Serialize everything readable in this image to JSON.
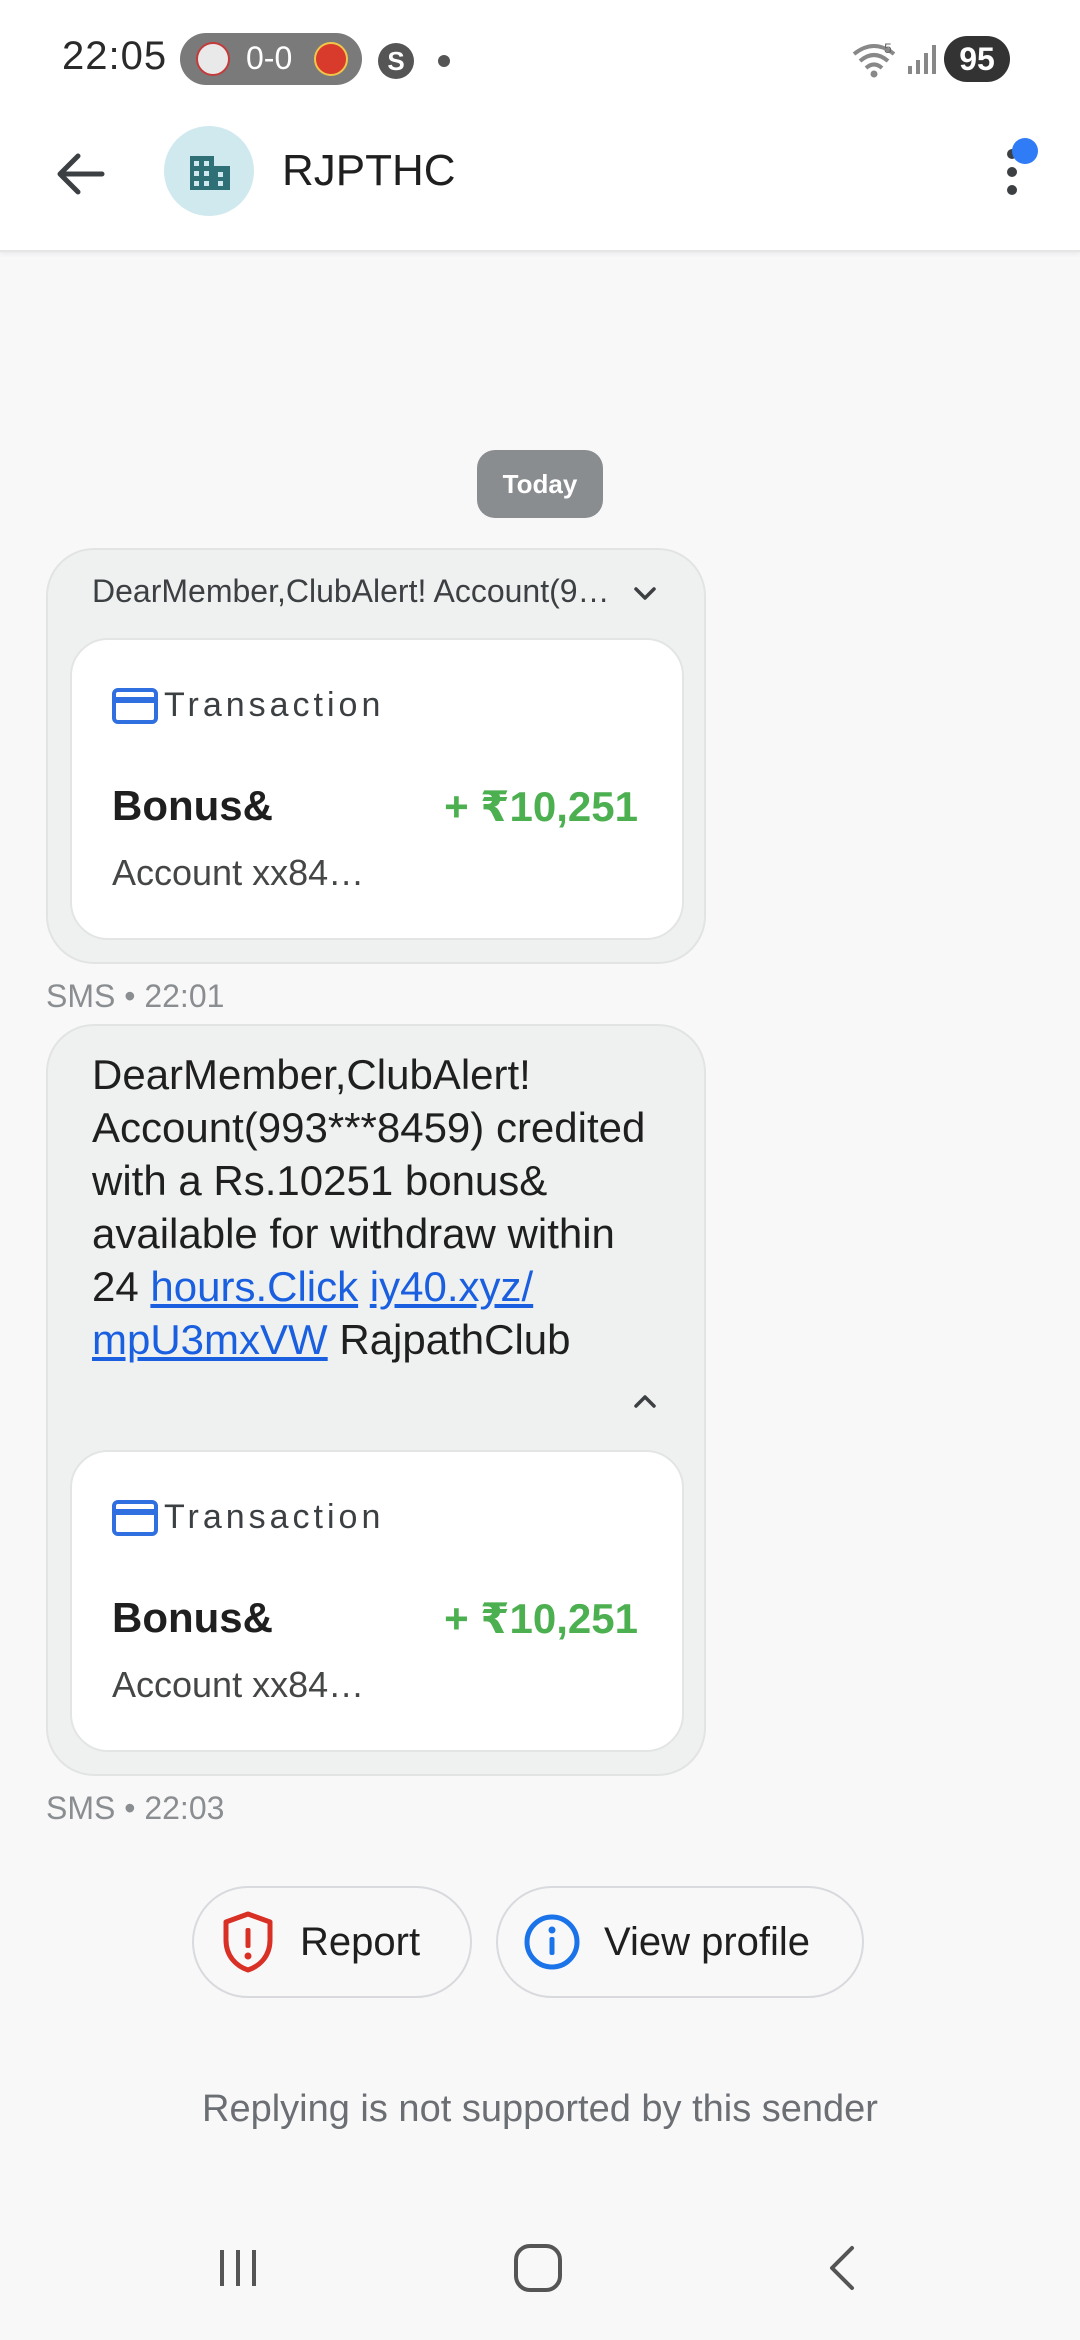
{
  "status_bar": {
    "time": "22:05",
    "score": "0-0",
    "s_badge": "S",
    "wifi_badge": "5",
    "battery": "95"
  },
  "header": {
    "contact_name": "RJPTHC"
  },
  "conversation": {
    "date_chip": "Today",
    "messages": [
      {
        "preview": "DearMember,ClubAlert! Account(9…",
        "card": {
          "label": "Transaction",
          "title": "Bonus&",
          "amount": "+ ₹10,251",
          "subtitle": "Account xx84…"
        },
        "meta": "SMS • 22:01"
      },
      {
        "text_plain": "DearMember,ClubAlert! Account(993***8459) credited with a Rs.10251 bonus& available for withdraw within 24",
        "link1": "hours.Click",
        "link2_line1": "iy40.xyz/",
        "link2_line2": "mpU3mxVW",
        "text_tail": "RajpathClub",
        "card": {
          "label": "Transaction",
          "title": "Bonus&",
          "amount": "+ ₹10,251",
          "subtitle": "Account xx84…"
        },
        "meta": "SMS • 22:03"
      }
    ]
  },
  "actions": {
    "report_label": "Report",
    "view_profile_label": "View profile"
  },
  "footer": {
    "reply_note": "Replying is not supported by this sender"
  },
  "colors": {
    "amount_green": "#4caf50",
    "link_blue": "#1a5fe0",
    "report_red": "#d93025",
    "info_blue": "#1a73e8",
    "accent_dot": "#2f7cf6"
  }
}
